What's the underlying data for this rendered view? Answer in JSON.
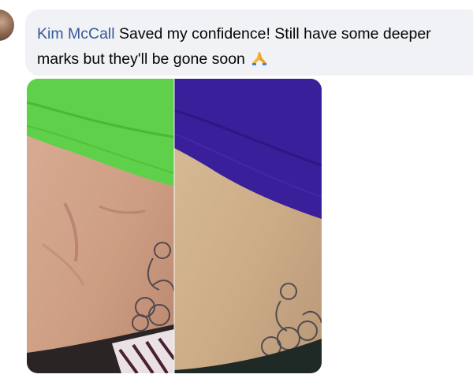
{
  "comment": {
    "author": "Kim McCall",
    "text": "Saved my confidence! Still have some deeper marks but they'll be gone soon",
    "emoji_icon": "folded-hands-icon"
  },
  "photo": {
    "left_panel": {
      "shirt_color": "#5fd04a",
      "skin_color": "#d3a488"
    },
    "right_panel": {
      "shirt_color": "#3a1f9a",
      "skin_color": "#cfb08a"
    }
  }
}
